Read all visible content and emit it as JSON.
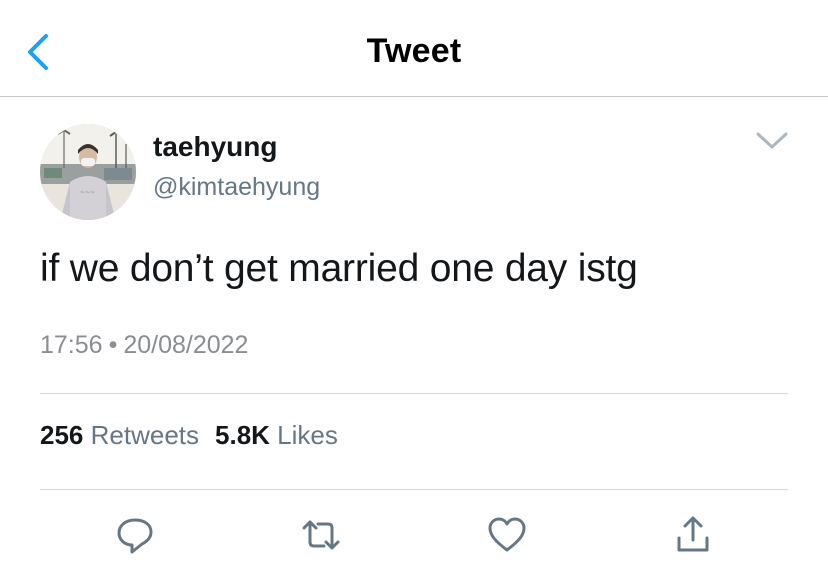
{
  "header": {
    "title": "Tweet",
    "back_icon": "chevron-left-icon",
    "accent": "#1da1f2"
  },
  "tweet": {
    "author_name": "taehyung",
    "author_handle": "@kimtaehyung",
    "text": "if we don’t get married one day istg",
    "time": "17:56",
    "separator": "•",
    "date": "20/08/2022"
  },
  "stats": {
    "retweets_count": "256",
    "retweets_label": "Retweets",
    "likes_count": "5.8K",
    "likes_label": "Likes"
  },
  "actions": {
    "icons": [
      "reply-icon",
      "retweet-icon",
      "like-icon",
      "share-icon"
    ],
    "color": "#657786"
  }
}
